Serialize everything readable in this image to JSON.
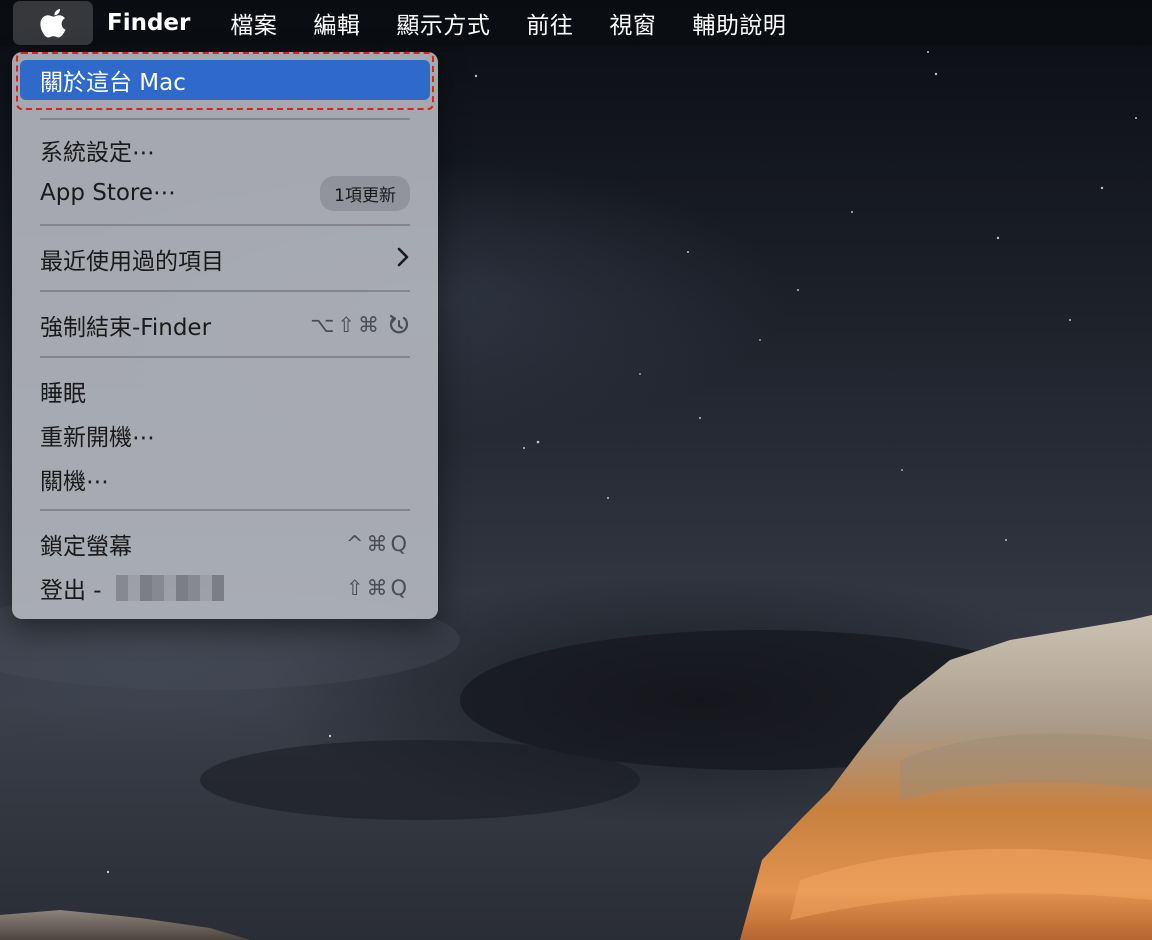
{
  "menubar": {
    "apple_icon": "apple-logo-icon",
    "app_name": "Finder",
    "items": [
      "檔案",
      "編輯",
      "顯示方式",
      "前往",
      "視窗",
      "輔助說明"
    ]
  },
  "apple_menu": {
    "about": "關於這台 Mac",
    "system_settings": "系統設定⋯",
    "app_store": "App Store⋯",
    "app_store_badge": "1項更新",
    "recent_items": "最近使用過的項目",
    "force_quit": "強制結束-Finder",
    "force_quit_shortcut": "⌥⇧⌘",
    "sleep": "睡眠",
    "restart": "重新開機⋯",
    "shutdown": "關機⋯",
    "lock_screen": "鎖定螢幕",
    "lock_screen_shortcut": "^⌘Q",
    "logout": "登出 -",
    "logout_shortcut": "⇧⌘Q"
  },
  "colors": {
    "highlight": "#2f69c9",
    "outline": "#e01e1e",
    "menu_background": "#b2b5bc"
  }
}
